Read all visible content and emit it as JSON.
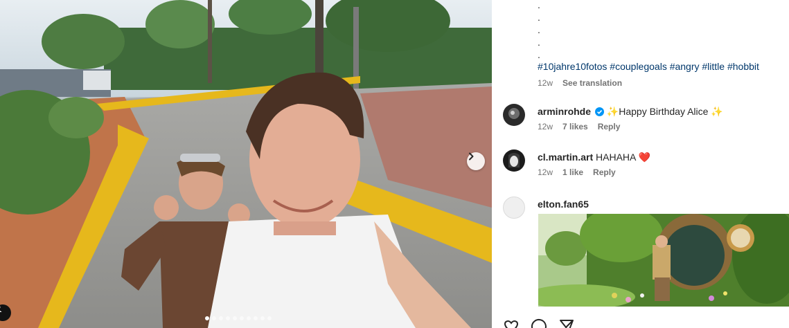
{
  "photo": {
    "next_label": "›",
    "carousel_dots": 10,
    "active_dot": 0
  },
  "caption": {
    "dots": [
      ".",
      ".",
      ".",
      ".",
      "."
    ],
    "hashtags": "#10jahre10fotos #couplegoals #angry #little #hobbit",
    "time": "12w",
    "see_translation": "See translation"
  },
  "comments": [
    {
      "username": "arminrohde",
      "verified": true,
      "text_prefix": "✨",
      "text": "Happy Birthday Alice",
      "text_suffix": "✨",
      "time": "12w",
      "likes": "7 likes",
      "reply": "Reply"
    },
    {
      "username": "cl.martin.art",
      "text": "HAHAHA",
      "text_suffix": "❤️",
      "time": "12w",
      "likes": "1 like",
      "reply": "Reply"
    },
    {
      "username": "elton.fan65",
      "has_image": true
    }
  ],
  "colors": {
    "link": "#00376b",
    "muted": "#737373",
    "verified": "#0095f6",
    "heart": "#ed4956"
  }
}
